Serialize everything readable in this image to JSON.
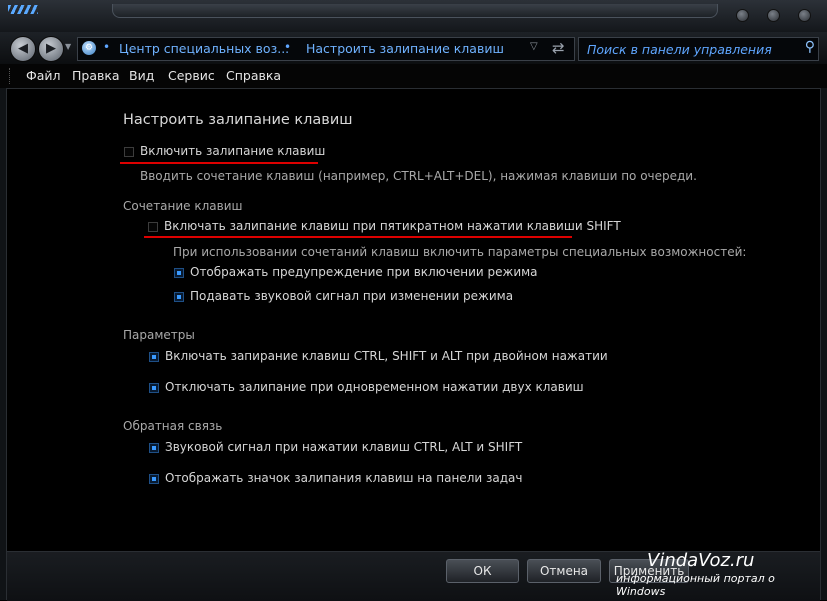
{
  "address_bar": {
    "breadcrumbs": [
      "Центр специальных воз...",
      "Настроить залипание клавиш"
    ],
    "search_placeholder": "Поиск в панели управления"
  },
  "menu": [
    "Файл",
    "Правка",
    "Вид",
    "Сервис",
    "Справка"
  ],
  "page": {
    "title": "Настроить залипание клавиш",
    "main_option": {
      "label": "Включить залипание клавиш",
      "checked": false,
      "description": "Вводить сочетание клавиш (например, CTRL+ALT+DEL), нажимая клавиши по очереди."
    },
    "sections": [
      {
        "heading": "Сочетание клавиш",
        "options": [
          {
            "label": "Включать залипание клавиш при пятикратном нажатии клавиши SHIFT",
            "checked": false
          }
        ],
        "subtext": "При использовании сочетаний клавиш включить параметры специальных возможностей:",
        "sub_options": [
          {
            "label": "Отображать предупреждение при включении режима",
            "checked": true
          },
          {
            "label": "Подавать звуковой сигнал при изменении режима",
            "checked": true
          }
        ]
      },
      {
        "heading": "Параметры",
        "options": [
          {
            "label": "Включать запирание клавиш CTRL, SHIFT и ALT при двойном нажатии",
            "checked": true
          },
          {
            "label": "Отключать залипание при одновременном нажатии двух клавиш",
            "checked": true
          }
        ]
      },
      {
        "heading": "Обратная связь",
        "options": [
          {
            "label": "Звуковой сигнал при нажатии клавиш CTRL, ALT и SHIFT",
            "checked": true
          },
          {
            "label": "Отображать значок залипания клавиш на панели задач",
            "checked": true
          }
        ]
      }
    ]
  },
  "buttons": {
    "ok": "ОК",
    "cancel": "Отмена",
    "apply": "Применить"
  },
  "watermark": {
    "site": "VindaVoz.ru",
    "tagline": "информационный портал о Windows"
  },
  "colors": {
    "link_blue": "#6fb2ff",
    "underline_red": "#dd0000",
    "checkbox_fill": "#3a9aff"
  }
}
